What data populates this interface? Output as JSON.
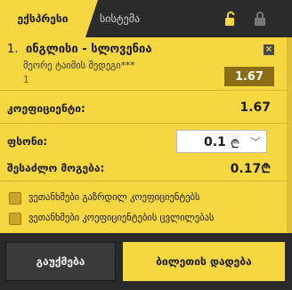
{
  "tabs": {
    "express": "ექსპრესი",
    "system": "სისტემა"
  },
  "bet": {
    "number": "1.",
    "match": "ინგლისი - სლოვენია",
    "market": "მეორე ტაიმის შედეგი***",
    "selection": "1",
    "odd": "1.67",
    "close": "×"
  },
  "coefficient": {
    "label": "კოეფიციენტი:",
    "value": "1.67"
  },
  "stake": {
    "label": "ფსონი:",
    "value": "0.1",
    "currency": "₾"
  },
  "possible_win": {
    "label": "შესაძლო მოგება:",
    "value": "0.17",
    "currency": "₾"
  },
  "options": [
    {
      "label": "ვეთანხმები გაზრდილ კოეფიციენტებს"
    },
    {
      "label": "ვეთანხმები კოეფიციენტების ცვლილებას"
    }
  ],
  "buttons": {
    "clear": "გაუქმება",
    "place": "ბილეთის დადება"
  }
}
